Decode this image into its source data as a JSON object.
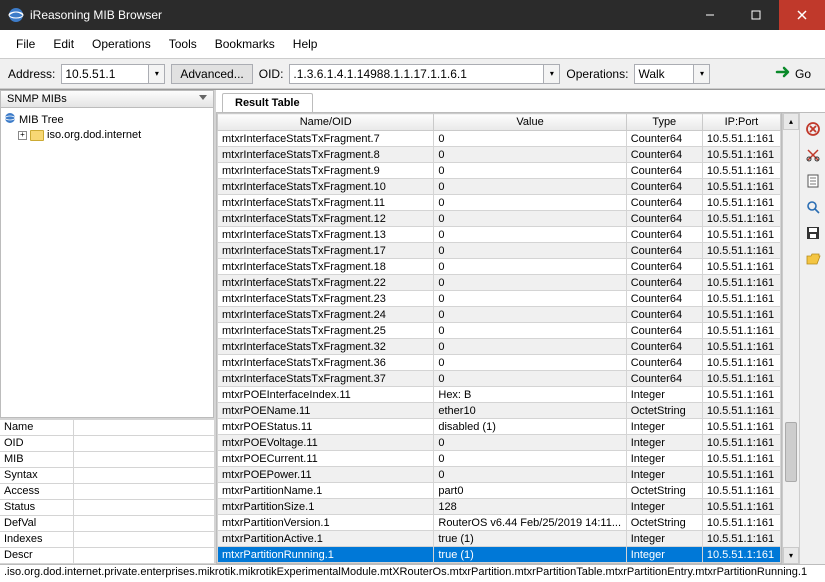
{
  "window": {
    "title": "iReasoning MIB Browser"
  },
  "menu": {
    "file": "File",
    "edit": "Edit",
    "operations": "Operations",
    "tools": "Tools",
    "bookmarks": "Bookmarks",
    "help": "Help"
  },
  "toolbar": {
    "address_label": "Address:",
    "address_value": "10.5.51.1",
    "advanced_label": "Advanced...",
    "oid_label": "OID:",
    "oid_value": ".1.3.6.1.4.1.14988.1.1.17.1.1.6.1",
    "operations_label": "Operations:",
    "operations_value": "Walk",
    "go_label": "Go"
  },
  "left": {
    "mibs_header": "SNMP MIBs",
    "tree_root": "MIB Tree",
    "tree_child": "iso.org.dod.internet",
    "detail_labels": {
      "name": "Name",
      "oid": "OID",
      "mib": "MIB",
      "syntax": "Syntax",
      "access": "Access",
      "status": "Status",
      "defval": "DefVal",
      "indexes": "Indexes",
      "descr": "Descr"
    }
  },
  "tab": {
    "result": "Result Table"
  },
  "grid": {
    "headers": {
      "name": "Name/OID",
      "value": "Value",
      "type": "Type",
      "ipport": "IP:Port"
    },
    "rows": [
      {
        "n": "mtxrInterfaceStatsTxFragment.7",
        "v": "0",
        "t": "Counter64",
        "ip": "10.5.51.1:161"
      },
      {
        "n": "mtxrInterfaceStatsTxFragment.8",
        "v": "0",
        "t": "Counter64",
        "ip": "10.5.51.1:161"
      },
      {
        "n": "mtxrInterfaceStatsTxFragment.9",
        "v": "0",
        "t": "Counter64",
        "ip": "10.5.51.1:161"
      },
      {
        "n": "mtxrInterfaceStatsTxFragment.10",
        "v": "0",
        "t": "Counter64",
        "ip": "10.5.51.1:161"
      },
      {
        "n": "mtxrInterfaceStatsTxFragment.11",
        "v": "0",
        "t": "Counter64",
        "ip": "10.5.51.1:161"
      },
      {
        "n": "mtxrInterfaceStatsTxFragment.12",
        "v": "0",
        "t": "Counter64",
        "ip": "10.5.51.1:161"
      },
      {
        "n": "mtxrInterfaceStatsTxFragment.13",
        "v": "0",
        "t": "Counter64",
        "ip": "10.5.51.1:161"
      },
      {
        "n": "mtxrInterfaceStatsTxFragment.17",
        "v": "0",
        "t": "Counter64",
        "ip": "10.5.51.1:161"
      },
      {
        "n": "mtxrInterfaceStatsTxFragment.18",
        "v": "0",
        "t": "Counter64",
        "ip": "10.5.51.1:161"
      },
      {
        "n": "mtxrInterfaceStatsTxFragment.22",
        "v": "0",
        "t": "Counter64",
        "ip": "10.5.51.1:161"
      },
      {
        "n": "mtxrInterfaceStatsTxFragment.23",
        "v": "0",
        "t": "Counter64",
        "ip": "10.5.51.1:161"
      },
      {
        "n": "mtxrInterfaceStatsTxFragment.24",
        "v": "0",
        "t": "Counter64",
        "ip": "10.5.51.1:161"
      },
      {
        "n": "mtxrInterfaceStatsTxFragment.25",
        "v": "0",
        "t": "Counter64",
        "ip": "10.5.51.1:161"
      },
      {
        "n": "mtxrInterfaceStatsTxFragment.32",
        "v": "0",
        "t": "Counter64",
        "ip": "10.5.51.1:161"
      },
      {
        "n": "mtxrInterfaceStatsTxFragment.36",
        "v": "0",
        "t": "Counter64",
        "ip": "10.5.51.1:161"
      },
      {
        "n": "mtxrInterfaceStatsTxFragment.37",
        "v": "0",
        "t": "Counter64",
        "ip": "10.5.51.1:161"
      },
      {
        "n": "mtxrPOEInterfaceIndex.11",
        "v": "Hex: B",
        "t": "Integer",
        "ip": "10.5.51.1:161"
      },
      {
        "n": "mtxrPOEName.11",
        "v": "ether10",
        "t": "OctetString",
        "ip": "10.5.51.1:161"
      },
      {
        "n": "mtxrPOEStatus.11",
        "v": "disabled (1)",
        "t": "Integer",
        "ip": "10.5.51.1:161"
      },
      {
        "n": "mtxrPOEVoltage.11",
        "v": "0",
        "t": "Integer",
        "ip": "10.5.51.1:161"
      },
      {
        "n": "mtxrPOECurrent.11",
        "v": "0",
        "t": "Integer",
        "ip": "10.5.51.1:161"
      },
      {
        "n": "mtxrPOEPower.11",
        "v": "0",
        "t": "Integer",
        "ip": "10.5.51.1:161"
      },
      {
        "n": "mtxrPartitionName.1",
        "v": "part0",
        "t": "OctetString",
        "ip": "10.5.51.1:161"
      },
      {
        "n": "mtxrPartitionSize.1",
        "v": "128",
        "t": "Integer",
        "ip": "10.5.51.1:161"
      },
      {
        "n": "mtxrPartitionVersion.1",
        "v": "RouterOS v6.44 Feb/25/2019 14:11...",
        "t": "OctetString",
        "ip": "10.5.51.1:161"
      },
      {
        "n": "mtxrPartitionActive.1",
        "v": "true (1)",
        "t": "Integer",
        "ip": "10.5.51.1:161"
      },
      {
        "n": "mtxrPartitionRunning.1",
        "v": "true (1)",
        "t": "Integer",
        "ip": "10.5.51.1:161",
        "sel": true
      }
    ]
  },
  "status": ".iso.org.dod.internet.private.enterprises.mikrotik.mikrotikExperimentalModule.mtXRouterOs.mtxrPartition.mtxrPartitionTable.mtxrPartitionEntry.mtxrPartitionRunning.1"
}
